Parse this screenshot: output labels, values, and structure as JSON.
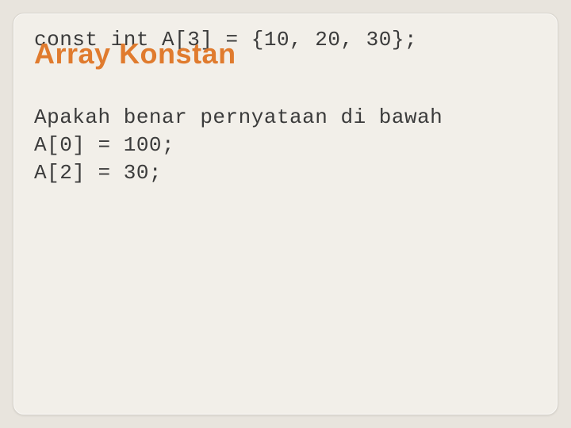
{
  "slide": {
    "heading": "Array Konstan",
    "code_declaration": "const int A[3] = {10, 20, 30};",
    "question_line": "Apakah benar pernyataan di bawah",
    "stmt1": "A[0] = 100;",
    "stmt2": "A[2] = 30;"
  },
  "colors": {
    "background_outer": "#e8e4dd",
    "background_inner": "#f2efe9",
    "heading": "#e07b2e",
    "text": "#3b3b3b"
  }
}
